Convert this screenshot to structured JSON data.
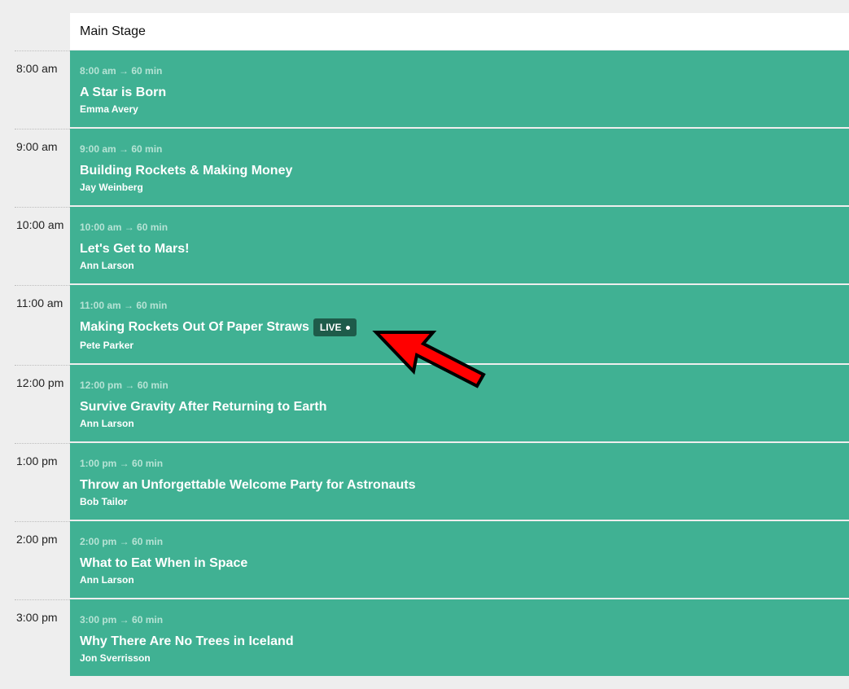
{
  "stage": {
    "name": "Main Stage"
  },
  "slots": [
    {
      "label": "8:00 am",
      "event": {
        "time": "8:00 am → 60 min",
        "title": "A Star is Born",
        "speaker": "Emma Avery"
      }
    },
    {
      "label": "9:00 am",
      "event": {
        "time": "9:00 am → 60 min",
        "title": "Building Rockets & Making Money",
        "speaker": "Jay Weinberg"
      }
    },
    {
      "label": "10:00 am",
      "event": {
        "time": "10:00 am → 60 min",
        "title": "Let's Get to Mars!",
        "speaker": "Ann Larson"
      }
    },
    {
      "label": "11:00 am",
      "event": {
        "time": "11:00 am → 60 min",
        "title": "Making Rockets Out Of Paper Straws",
        "speaker": "Pete Parker",
        "badge": "LIVE"
      }
    },
    {
      "label": "12:00 pm",
      "event": {
        "time": "12:00 pm → 60 min",
        "title": "Survive Gravity After Returning to Earth",
        "speaker": "Ann Larson"
      }
    },
    {
      "label": "1:00 pm",
      "event": {
        "time": "1:00 pm → 60 min",
        "title": "Throw an Unforgettable Welcome Party for Astronauts",
        "speaker": "Bob Tailor"
      }
    },
    {
      "label": "2:00 pm",
      "event": {
        "time": "2:00 pm → 60 min",
        "title": "What to Eat When in Space",
        "speaker": "Ann Larson"
      }
    },
    {
      "label": "3:00 pm",
      "event": {
        "time": "3:00 pm → 60 min",
        "title": "Why There Are No Trees in Iceland",
        "speaker": "Jon Sverrisson"
      }
    }
  ],
  "colors": {
    "event_bg": "#40b193",
    "live_badge_bg": "#1e5b4a",
    "page_bg": "#eeeeee",
    "arrow": "#ff0000"
  },
  "icons": {
    "arrow": "red-arrow-pointer-icon",
    "live_dot": "live-dot-icon"
  }
}
